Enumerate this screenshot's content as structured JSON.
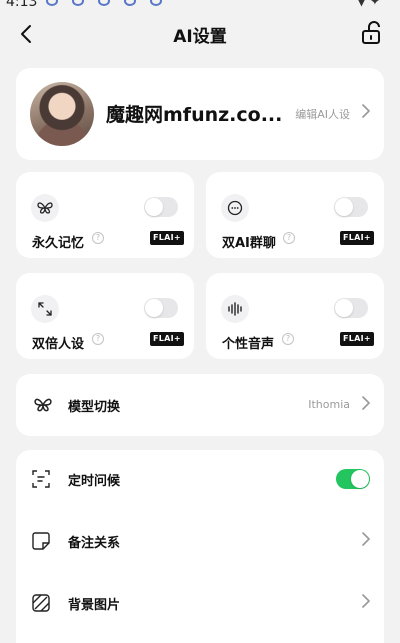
{
  "status_bar": {
    "time": "4:13"
  },
  "nav": {
    "title": "AI设置"
  },
  "profile": {
    "name": "魔趣网mfunz.co...",
    "edit_label": "编辑AI人设"
  },
  "features": [
    {
      "label": "永久记忆",
      "badge": "FLAI+",
      "enabled": false,
      "icon": "butterfly-icon"
    },
    {
      "label": "双AI群聊",
      "badge": "FLAI+",
      "enabled": false,
      "icon": "chat-bubbles-icon"
    },
    {
      "label": "双倍人设",
      "badge": "FLAI+",
      "enabled": false,
      "icon": "expand-arrows-icon"
    },
    {
      "label": "个性音声",
      "badge": "FLAI+",
      "enabled": false,
      "icon": "waveform-icon"
    }
  ],
  "model": {
    "label": "模型切换",
    "value": "Ithomia"
  },
  "settings": [
    {
      "label": "定时问候",
      "type": "toggle",
      "enabled": true,
      "icon": "scan-text-icon"
    },
    {
      "label": "备注关系",
      "type": "link",
      "icon": "note-icon"
    },
    {
      "label": "背景图片",
      "type": "link",
      "icon": "striped-square-icon"
    }
  ],
  "colors": {
    "toggle_on": "#22c55e",
    "background": "#f2f2f3",
    "badge": "#111111"
  }
}
